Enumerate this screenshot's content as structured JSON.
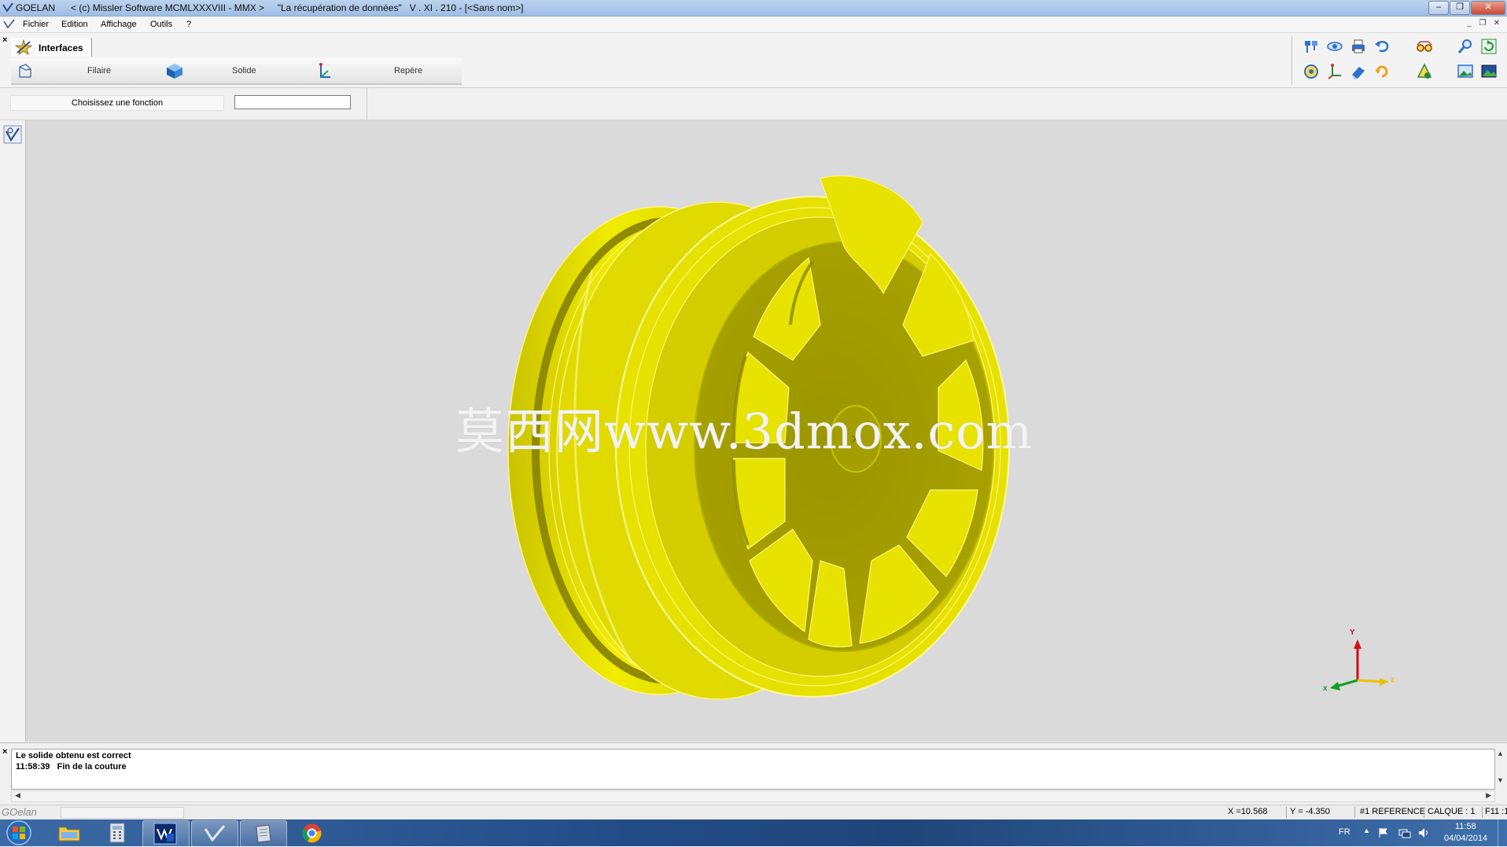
{
  "window": {
    "title": "GOELAN      < (c) Missler Software MCMLXXXVIII - MMX >     \"La récupération de données\"   V . XI . 210 - [<Sans nom>]",
    "controls": {
      "minimize": "–",
      "restore": "❐",
      "close": "✕"
    },
    "mdi_controls": {
      "minimize": "_",
      "restore": "❐",
      "close": "✕"
    }
  },
  "menubar": {
    "items": [
      "Fichier",
      "Edition",
      "Affichage",
      "Outils",
      "?"
    ]
  },
  "panel": {
    "tab_label": "Interfaces",
    "functions": [
      {
        "label": "Filaire",
        "icon": "wireframe-icon"
      },
      {
        "label": "Solide",
        "icon": "solid-cube-icon"
      },
      {
        "label": "Repère",
        "icon": "axis-frame-icon"
      }
    ],
    "prompt_label": "Choisissez une fonction",
    "prompt_input": ""
  },
  "viewport": {
    "model": "yellow alloy wheel",
    "model_color": "#e6e000",
    "background": "#dadada",
    "watermark": "莫西网www.3dmox.com",
    "axis": {
      "x_label": "x",
      "y_label": "Y",
      "z_label": "z"
    }
  },
  "output": {
    "lines": [
      "Le solide obtenu est correct",
      "11:58:39   Fin de la couture"
    ],
    "close_glyph": "×"
  },
  "status": {
    "app_name": "GOelan",
    "x": "X =10.568",
    "y": "Y = -4.350",
    "reference": "#1 REFERENCE",
    "calque": "CALQUE : 1",
    "f11": "F11 :1"
  },
  "taskbar": {
    "lang": "FR",
    "time": "11:58",
    "date": "04/04/2014"
  }
}
